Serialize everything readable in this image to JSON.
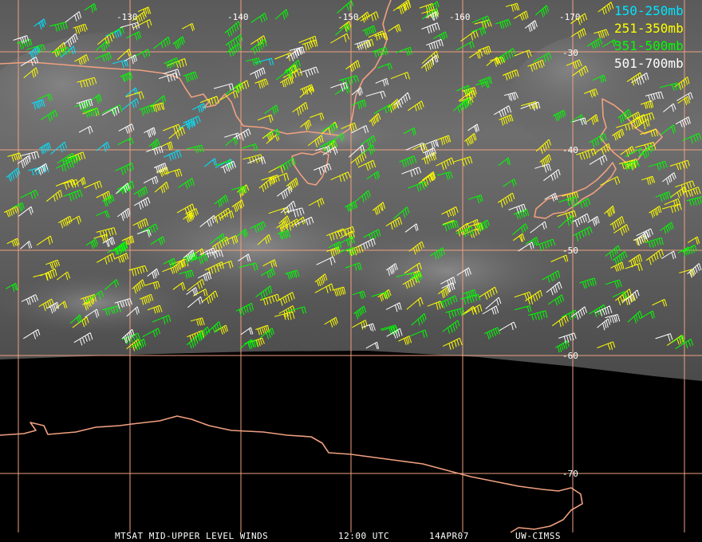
{
  "legend": {
    "items": [
      {
        "label": "150-250mb",
        "color": "#00e5ff"
      },
      {
        "label": "251-350mb",
        "color": "#ffff00"
      },
      {
        "label": "351-500mb",
        "color": "#00ff00"
      },
      {
        "label": "501-700mb",
        "color": "#ffffff"
      }
    ]
  },
  "grid": {
    "longitude_labels": [
      "-130",
      "-140",
      "-150",
      "-160",
      "-170"
    ],
    "latitude_labels": [
      "-30",
      "-40",
      "-50",
      "-60",
      "-70"
    ],
    "grid_color": "#f0a080",
    "coast_color": "#f0a080"
  },
  "footer": {
    "product": "MTSAT MID-UPPER LEVEL WINDS",
    "time": "12:00 UTC",
    "date": "14APR07",
    "source": "UW-CIMSS"
  }
}
